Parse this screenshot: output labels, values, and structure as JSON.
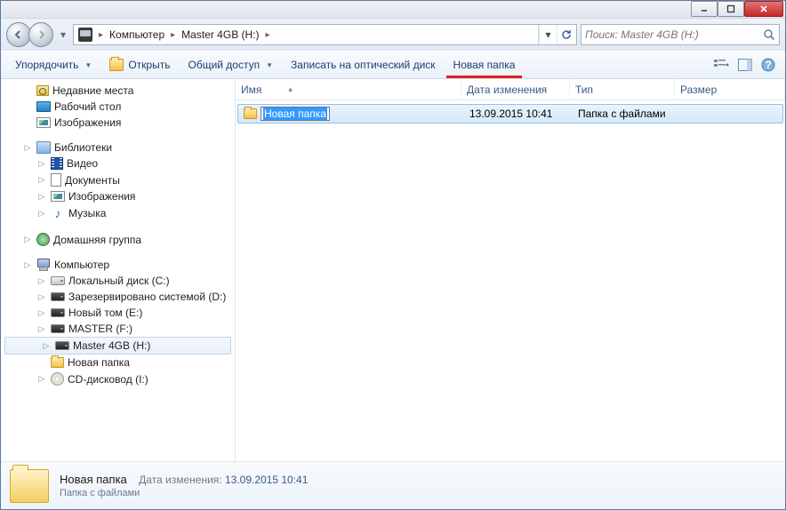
{
  "window": {
    "minimize": "",
    "maximize": "",
    "close": ""
  },
  "breadcrumb": {
    "root": "Компьютер",
    "drive": "Master 4GB (H:)"
  },
  "search": {
    "placeholder": "Поиск: Master 4GB (H:)"
  },
  "toolbar": {
    "organize": "Упорядочить",
    "open": "Открыть",
    "share": "Общий доступ",
    "burn": "Записать на оптический диск",
    "newfolder": "Новая папка"
  },
  "sidebar": {
    "fav": {
      "recent": "Недавние места",
      "desktop": "Рабочий стол",
      "pictures": "Изображения"
    },
    "lib": {
      "header": "Библиотеки",
      "video": "Видео",
      "docs": "Документы",
      "pics": "Изображения",
      "music": "Музыка"
    },
    "hg": "Домашняя группа",
    "pc": {
      "header": "Компьютер",
      "c": "Локальный диск (C:)",
      "d": "Зарезервировано системой (D:)",
      "e": "Новый том (E:)",
      "f": "MASTER (F:)",
      "h": "Master 4GB (H:)",
      "hnew": "Новая папка",
      "cd": "CD-дисковод (I:)"
    }
  },
  "columns": {
    "name": "Имя",
    "date": "Дата изменения",
    "type": "Тип",
    "size": "Размер"
  },
  "rows": [
    {
      "name": "Новая папка",
      "date": "13.09.2015 10:41",
      "type": "Папка с файлами"
    }
  ],
  "details": {
    "title": "Новая папка",
    "type": "Папка с файлами",
    "modlabel": "Дата изменения:",
    "modval": "13.09.2015 10:41"
  }
}
